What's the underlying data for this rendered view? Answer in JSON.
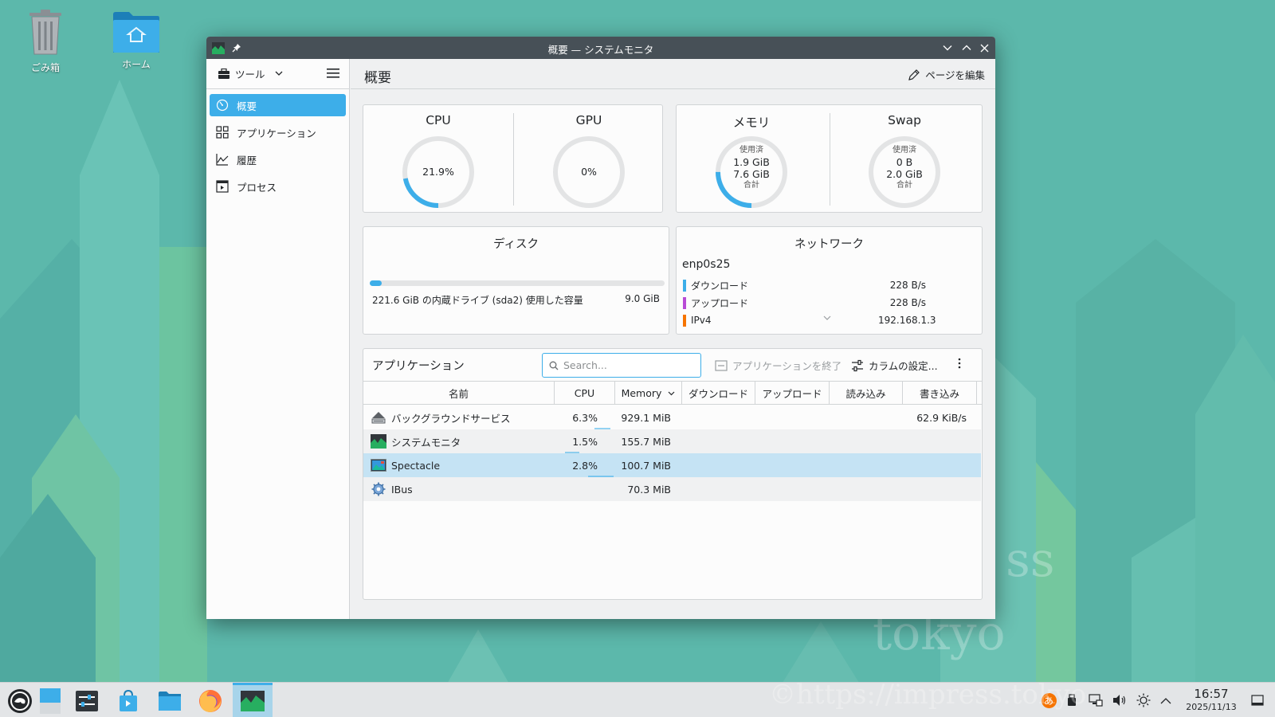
{
  "desktop": {
    "icons": [
      {
        "label": "ごみ箱",
        "icon": "trash-icon"
      },
      {
        "label": "ホーム",
        "icon": "home-folder-icon"
      }
    ],
    "watermark": {
      "text1": "ss",
      "text2": "tokyo",
      "text3": "©https://impress.tokyo"
    }
  },
  "window": {
    "title": "概要 — システムモニタ"
  },
  "sidebar": {
    "tools_label": "ツール",
    "items": [
      {
        "label": "概要",
        "icon": "overview-icon",
        "active": true
      },
      {
        "label": "アプリケーション",
        "icon": "grid-icon",
        "active": false
      },
      {
        "label": "履歴",
        "icon": "chart-icon",
        "active": false
      },
      {
        "label": "プロセス",
        "icon": "process-icon",
        "active": false
      }
    ]
  },
  "main": {
    "page_title": "概要",
    "edit_page_label": "ページを編集"
  },
  "gauges": {
    "cpu": {
      "title": "CPU",
      "value": "21.9%",
      "fraction": 0.219
    },
    "gpu": {
      "title": "GPU",
      "value": "0%",
      "fraction": 0
    },
    "memory": {
      "title": "メモリ",
      "top_label": "使用済",
      "used": "1.9 GiB",
      "total": "7.6 GiB",
      "bottom_label": "合計",
      "fraction": 0.25
    },
    "swap": {
      "title": "Swap",
      "top_label": "使用済",
      "used": "0 B",
      "total": "2.0 GiB",
      "bottom_label": "合計",
      "fraction": 0
    }
  },
  "disk": {
    "title": "ディスク",
    "label": "221.6 GiB の内蔵ドライブ (sda2) 使用した容量",
    "used": "9.0 GiB",
    "fraction": 0.04
  },
  "network": {
    "title": "ネットワーク",
    "interface": "enp0s25",
    "rows": [
      {
        "label": "ダウンロード",
        "value": "228 B/s",
        "color": "#3daee9"
      },
      {
        "label": "アップロード",
        "value": "228 B/s",
        "color": "#b84bd6"
      },
      {
        "label": "IPv4",
        "value": "192.168.1.3",
        "color": "#f67400"
      }
    ]
  },
  "apps": {
    "title": "アプリケーション",
    "search_placeholder": "Search...",
    "end_app_label": "アプリケーションを終了",
    "columns_label": "カラムの設定...",
    "headers": [
      "名前",
      "CPU",
      "Memory",
      "ダウンロード",
      "アップロード",
      "読み込み",
      "書き込み"
    ],
    "rows": [
      {
        "name": "バックグラウンドサービス",
        "cpu": "6.3%",
        "memory": "929.1 MiB",
        "download": "",
        "upload": "",
        "read": "",
        "write": "62.9 KiB/s",
        "icon": "background-services-icon"
      },
      {
        "name": "システムモニタ",
        "cpu": "1.5%",
        "memory": "155.7 MiB",
        "download": "",
        "upload": "",
        "read": "",
        "write": "",
        "icon": "system-monitor-icon"
      },
      {
        "name": "Spectacle",
        "cpu": "2.8%",
        "memory": "100.7 MiB",
        "download": "",
        "upload": "",
        "read": "",
        "write": "",
        "icon": "spectacle-icon"
      },
      {
        "name": "IBus",
        "cpu": "",
        "memory": "70.3 MiB",
        "download": "",
        "upload": "",
        "read": "",
        "write": "",
        "icon": "ibus-icon"
      }
    ]
  },
  "taskbar": {
    "apps": [
      "opensuse-launcher-icon",
      "desktop-icon",
      "system-settings-icon",
      "discover-icon",
      "dolphin-icon",
      "firefox-icon",
      "system-monitor-icon"
    ],
    "tray": {
      "input_method": "あ"
    },
    "clock": {
      "time": "16:57",
      "date": "2025/11/13"
    }
  },
  "colors": {
    "accent": "#3daee9",
    "titlebar": "#475057",
    "selection": "#c5e3f4"
  }
}
